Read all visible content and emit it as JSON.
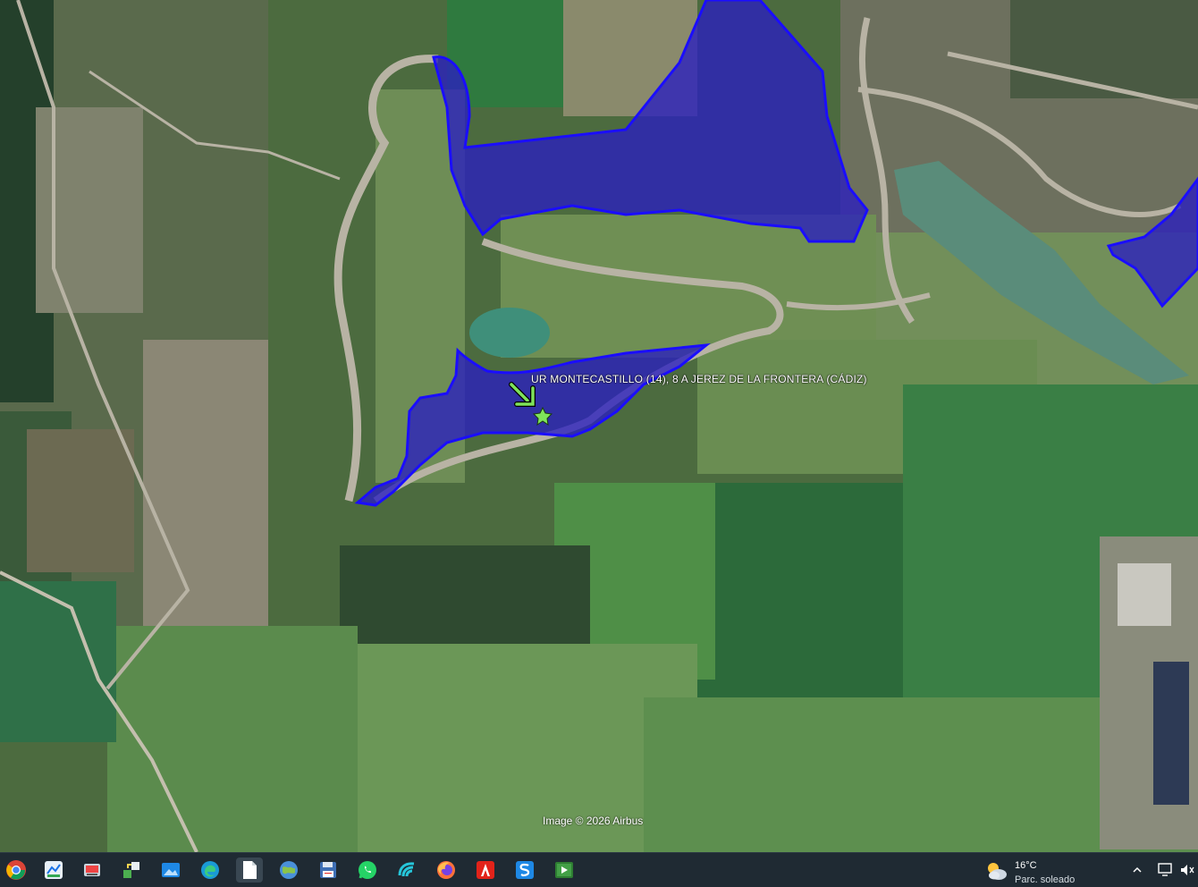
{
  "map": {
    "placemark_label": "UR MONTECASTILLO (14), 8 A JEREZ DE LA FRONTERA (CÁDIZ)",
    "attribution": "Image © 2026 Airbus",
    "colors": {
      "polygon_fill": "#2a1fbf",
      "polygon_stroke": "#1a0dff",
      "marker": "#7fe35a",
      "field_dark": "#2c6a3a",
      "field_light": "#5e8f4e",
      "road": "#b8b3a4",
      "water": "#5a8c7a"
    }
  },
  "taskbar": {
    "apps": [
      {
        "name": "chrome-icon",
        "label": "Google Chrome"
      },
      {
        "name": "map-app-icon",
        "label": "Maps"
      },
      {
        "name": "screenshot-tool-icon",
        "label": "Snipping Tool"
      },
      {
        "name": "network-share-icon",
        "label": "Network"
      },
      {
        "name": "photos-icon",
        "label": "Photos"
      },
      {
        "name": "edge-icon",
        "label": "Microsoft Edge"
      },
      {
        "name": "document-icon",
        "label": "Document"
      },
      {
        "name": "google-earth-icon",
        "label": "Google Earth"
      },
      {
        "name": "save-disk-icon",
        "label": "Save"
      },
      {
        "name": "whatsapp-icon",
        "label": "WhatsApp"
      },
      {
        "name": "wave-app-icon",
        "label": "App"
      },
      {
        "name": "firefox-icon",
        "label": "Firefox"
      },
      {
        "name": "acrobat-icon",
        "label": "Acrobat"
      },
      {
        "name": "s-app-icon",
        "label": "App S"
      },
      {
        "name": "media-player-icon",
        "label": "Media Player"
      }
    ],
    "weather": {
      "temperature": "16°C",
      "condition": "Parc. soleado"
    }
  }
}
